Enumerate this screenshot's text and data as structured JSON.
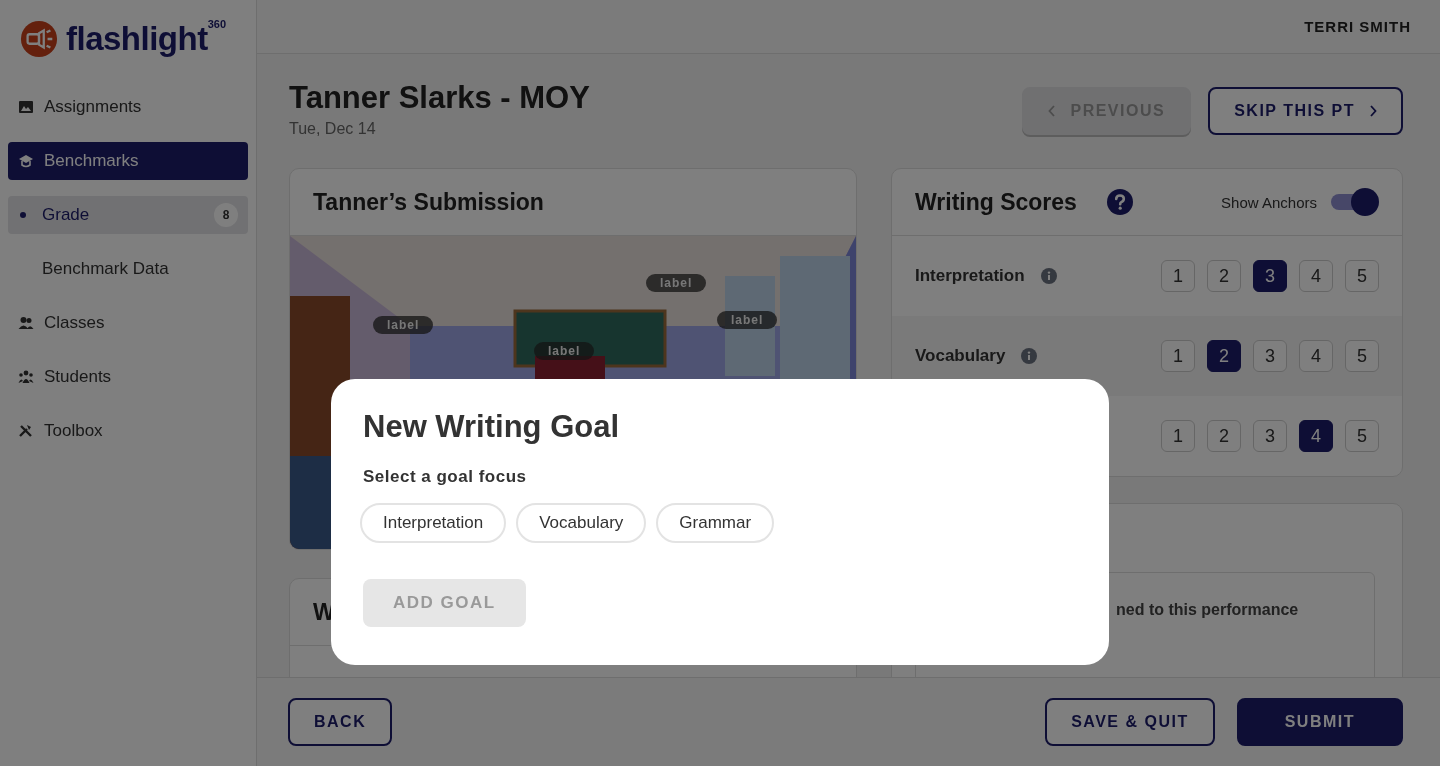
{
  "brand": {
    "name": "flashlight",
    "sup": "360"
  },
  "sidebar": {
    "items": [
      {
        "label": "Assignments",
        "selected": false
      },
      {
        "label": "Benchmarks",
        "selected": true,
        "children": [
          {
            "label": "Grade",
            "selected": true,
            "badge": "8"
          },
          {
            "label": "Benchmark Data",
            "selected": false
          }
        ]
      },
      {
        "label": "Classes",
        "selected": false
      },
      {
        "label": "Students",
        "selected": false
      },
      {
        "label": "Toolbox",
        "selected": false
      }
    ]
  },
  "topbar": {
    "user": "TERRI SMITH"
  },
  "header": {
    "title": "Tanner Slarks - MOY",
    "date": "Tue, Dec 14",
    "previous": {
      "label": "PREVIOUS",
      "disabled": true
    },
    "skip": {
      "label": "SKIP THIS PT",
      "disabled": false
    }
  },
  "submission": {
    "title": "Tanner’s Submission",
    "labels": [
      "label",
      "label",
      "label",
      "label"
    ]
  },
  "prompt_card": {
    "title": "W"
  },
  "scores": {
    "title": "Writing Scores",
    "toggle": {
      "label": "Show Anchors",
      "on": true
    },
    "rows": [
      {
        "label": "Interpretation",
        "options": [
          {
            "value": "1",
            "selected": false
          },
          {
            "value": "2",
            "selected": false
          },
          {
            "value": "3",
            "selected": true
          },
          {
            "value": "4",
            "selected": false
          },
          {
            "value": "5",
            "selected": false
          }
        ]
      },
      {
        "label": "Vocabulary",
        "options": [
          {
            "value": "1",
            "selected": false
          },
          {
            "value": "2",
            "selected": true
          },
          {
            "value": "3",
            "selected": false
          },
          {
            "value": "4",
            "selected": false
          },
          {
            "value": "5",
            "selected": false
          }
        ]
      },
      {
        "options": [
          {
            "value": "1",
            "selected": false
          },
          {
            "value": "2",
            "selected": false
          },
          {
            "value": "3",
            "selected": false
          },
          {
            "value": "4",
            "selected": true
          },
          {
            "value": "5",
            "selected": false
          }
        ]
      }
    ]
  },
  "goals_card": {
    "text": "ned to this performance"
  },
  "footer": {
    "back": "BACK",
    "save": "SAVE & QUIT",
    "submit": "SUBMIT"
  },
  "modal": {
    "title": "New Writing Goal",
    "prompt": "Select a goal focus",
    "chips": [
      {
        "label": "Interpretation",
        "selected": false
      },
      {
        "label": "Vocabulary",
        "selected": false
      },
      {
        "label": "Grammar",
        "selected": false
      }
    ],
    "add": {
      "label": "ADD GOAL",
      "disabled": true
    }
  }
}
